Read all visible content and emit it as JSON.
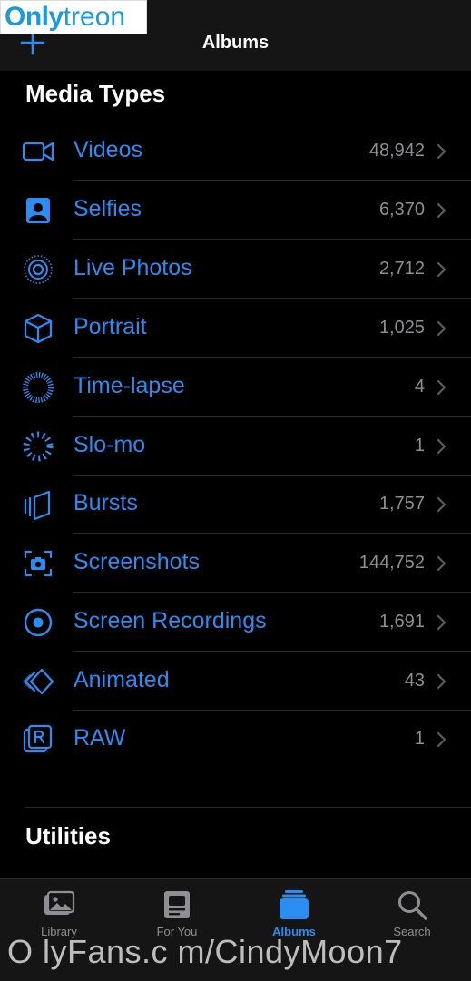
{
  "watermark": {
    "top_bold": "Only",
    "top_regular": "treon",
    "bottom": "O lyFans.c m/CindyMoon7"
  },
  "navbar": {
    "title": "Albums"
  },
  "sections": {
    "media_types": "Media Types",
    "utilities": "Utilities"
  },
  "media_types": [
    {
      "label": "Videos",
      "count": "48,942",
      "icon": "video-camera-icon"
    },
    {
      "label": "Selfies",
      "count": "6,370",
      "icon": "selfie-icon"
    },
    {
      "label": "Live Photos",
      "count": "2,712",
      "icon": "live-photo-icon"
    },
    {
      "label": "Portrait",
      "count": "1,025",
      "icon": "portrait-cube-icon"
    },
    {
      "label": "Time-lapse",
      "count": "4",
      "icon": "time-lapse-icon"
    },
    {
      "label": "Slo-mo",
      "count": "1",
      "icon": "slo-mo-icon"
    },
    {
      "label": "Bursts",
      "count": "1,757",
      "icon": "bursts-icon"
    },
    {
      "label": "Screenshots",
      "count": "144,752",
      "icon": "screenshot-icon"
    },
    {
      "label": "Screen Recordings",
      "count": "1,691",
      "icon": "screen-recording-icon"
    },
    {
      "label": "Animated",
      "count": "43",
      "icon": "animated-icon"
    },
    {
      "label": "RAW",
      "count": "1",
      "icon": "raw-icon"
    }
  ],
  "tabbar": {
    "items": [
      {
        "label": "Library",
        "icon": "library-photos-icon",
        "active": false
      },
      {
        "label": "For You",
        "icon": "for-you-icon",
        "active": false
      },
      {
        "label": "Albums",
        "icon": "albums-stack-icon",
        "active": true
      },
      {
        "label": "Search",
        "icon": "search-icon",
        "active": false
      }
    ]
  },
  "colors": {
    "accent": "#2b8cf2",
    "secondary_text": "#8e8e93",
    "background": "#000000",
    "bar_background": "#151515",
    "watermark_blue": "#1a9bd7"
  }
}
